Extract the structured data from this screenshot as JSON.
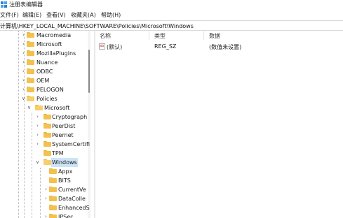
{
  "window": {
    "title": "注册表编辑器"
  },
  "menu": [
    "文件(F)",
    "编辑(E)",
    "查看(V)",
    "收藏夹(A)",
    "帮助(H)"
  ],
  "address": {
    "path": "计算机\\HKEY_LOCAL_MACHINE\\SOFTWARE\\Policies\\Microsoft\\Windows"
  },
  "tree": {
    "items": [
      {
        "label": "Macromedia",
        "level": 1,
        "expander": "collapsed"
      },
      {
        "label": "Microsoft",
        "level": 1,
        "expander": "collapsed"
      },
      {
        "label": "MozillaPlugins",
        "level": 1,
        "expander": "collapsed"
      },
      {
        "label": "Nuance",
        "level": 1,
        "expander": "collapsed"
      },
      {
        "label": "ODBC",
        "level": 1,
        "expander": "collapsed"
      },
      {
        "label": "OEM",
        "level": 1,
        "expander": "collapsed"
      },
      {
        "label": "PELOGON",
        "level": 1,
        "expander": "collapsed"
      },
      {
        "label": "Policies",
        "level": 1,
        "expander": "expanded"
      },
      {
        "label": "Microsoft",
        "level": 2,
        "expander": "expanded"
      },
      {
        "label": "Cryptograph",
        "level": 3,
        "expander": "collapsed"
      },
      {
        "label": "PeerDist",
        "level": 3,
        "expander": "collapsed"
      },
      {
        "label": "Peernet",
        "level": 3,
        "expander": "collapsed"
      },
      {
        "label": "SystemCertifi",
        "level": 3,
        "expander": "collapsed"
      },
      {
        "label": "TPM",
        "level": 3,
        "expander": "none"
      },
      {
        "label": "Windows",
        "level": 3,
        "expander": "expanded",
        "selected": true
      },
      {
        "label": "Appx",
        "level": 4,
        "expander": "none"
      },
      {
        "label": "BITS",
        "level": 4,
        "expander": "none"
      },
      {
        "label": "CurrentVe",
        "level": 4,
        "expander": "collapsed"
      },
      {
        "label": "DataColle",
        "level": 4,
        "expander": "collapsed"
      },
      {
        "label": "EnhancedS",
        "level": 4,
        "expander": "none"
      },
      {
        "label": "IPSec",
        "level": 4,
        "expander": "collapsed"
      }
    ]
  },
  "values": {
    "columns": [
      "名称",
      "类型",
      "数据"
    ],
    "rows": [
      {
        "name": "(默认)",
        "type": "REG_SZ",
        "data": "(数值未设置)",
        "icon": "string-value-icon"
      }
    ]
  },
  "colors": {
    "selection": "#cce4f7",
    "folder": "#f2c14e"
  }
}
